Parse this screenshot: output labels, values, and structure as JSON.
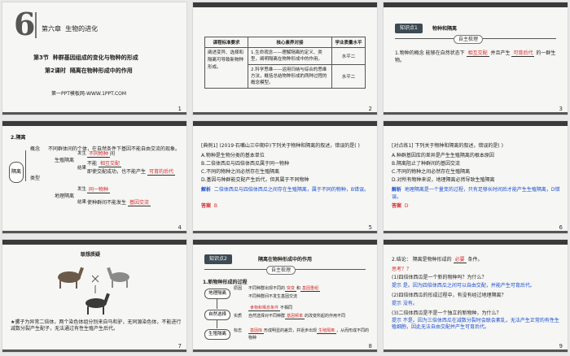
{
  "s1": {
    "big_num": "6",
    "chapter": "第六章",
    "chapter_title": "生物的进化",
    "section": "第3节",
    "section_title": "种群基因组成的变化与物种的形成",
    "lesson": "第2课时",
    "lesson_title": "隔离在物种形成中的作用",
    "credit": "第一PPT模板网-WWW.1PPT.COM",
    "page": "1"
  },
  "s2": {
    "headers": [
      "课程标准要求",
      "核心素养对接",
      "学业质量水平"
    ],
    "left_text": "阐述变异、选择和隔离可导致新物种形成。",
    "rows": [
      {
        "core": "1.生命观念——理解隔离的定义、类型，阐明隔离在物种形成中的作用。",
        "level": "水平二"
      },
      {
        "core": "2.科学思维——运用归纳与综合的思维方法，概括总结物种形成的两种过程的概念模型。",
        "level": "水平二"
      }
    ],
    "page": "2"
  },
  "s3": {
    "tab": "知识点1",
    "tab_title": "物种和隔离",
    "pill": "自主梳理",
    "line1_prefix": "1.物种的概念 能够在自然状态下",
    "blank1": "相互交配",
    "line1_mid": "并且产生",
    "blank2": "可育后代",
    "line1_suffix": "的一群生物。",
    "page": "3"
  },
  "s4": {
    "heading": "2.隔离",
    "root": "隔离",
    "concept_label": "概念",
    "concept_text": "不同群体间的个体，在自然条件下基因不能自由交流的现象。",
    "types_label": "类型",
    "geo": "地理隔离",
    "repro": "生殖隔离",
    "happen": "发生",
    "result": "结果",
    "fill_diff_species": "不同物种",
    "fill_between": "间",
    "cannot": "不能",
    "fill_mate": "相互交配",
    "even_if": "即使交配成功，也不能产生",
    "fill_fertile": "可育的后代",
    "fill_same": "同一物种",
    "makes": "使种群间不能发生",
    "fill_gene": "基因交流",
    "page": "4"
  },
  "s5": {
    "q": "[典例1] (2019·石嘴山三中期中)下列关于物种和隔离的叙述，错误的是(     )",
    "opts": [
      "A.物种是生物分类的基本单位",
      "B.二倍体西瓜与四倍体西瓜属于同一物种",
      "C.不同的物种之间必然存在生殖隔离",
      "D.基因与种群能交配产生后代，但其属于不同物种"
    ],
    "explain_label": "解析",
    "explain": "二倍体西瓜与四倍体西瓜之间存在生殖隔离，属于不同的物种，B错误。",
    "answer_label": "答案",
    "answer": "B",
    "page": "5"
  },
  "s6": {
    "q": "[对点练1] 下列关于物种和隔离的叙述，错误的是(     )",
    "opts": [
      "A.种群基因库的差异是产生生殖隔离的根本原因",
      "B.隔离阻止了种群间的基因交流",
      "C.不同的物种之间必然存在生殖隔离",
      "D.对所有物种来说，地理隔离必然导致生殖隔离"
    ],
    "explain_label": "解析",
    "explain": "地理隔离是一个量变的过程，只有足够长时间后才能产生生殖隔离，D错误。",
    "answer_label": "答案",
    "answer": "D",
    "page": "6"
  },
  "s7": {
    "title": "联想质疑",
    "caption": "★骡子为异常二倍体，两个染色体组分别来自马和驴，无同源染色体，不能进行减数分裂产生配子，无法通过有性生殖产生后代。",
    "page": "7"
  },
  "s8": {
    "tab": "知识点2",
    "tab_title": "隔离在物种形成中的作用",
    "pill": "自主梳理",
    "heading": "1.新物种形成的过程",
    "node1": "地理隔离",
    "node2": "自然选择",
    "node3": "生殖隔离",
    "b1": "原因",
    "b2": "实质",
    "b3": "标志",
    "t1a": "不同种群出现不同的",
    "t1b": "突变",
    "t1c": "和",
    "t1d": "基因重组",
    "t2": "不同种群间不发生基因交流",
    "t3a": "食物和栖息条件",
    "t3b": "不相同",
    "t4a": "自然选择对不同种群",
    "t4b": "基因频率",
    "t4c": "的改变所起的作用不同",
    "t5a": "基因库",
    "t5b": "形成明显的差异，并逐步出现",
    "t5c": "生殖隔离",
    "t5d": "，从而形成不同的物种",
    "page": "8"
  },
  "s9": {
    "line1a": "2.结论：",
    "line1b": "隔离是物种形成的",
    "line1c": "必要",
    "line1d": "条件。",
    "think": "思考？？",
    "q1": "(1)四倍体西瓜是一个新的物种吗？为什么？",
    "a1": "提示  是。因为四倍体西瓜之间可以自由交配，并能产生可育后代。",
    "q2": "(2)四倍体西瓜的形成过程中，有没有经过地理隔离？",
    "a2": "提示  没有。",
    "q3": "(3)二倍体西瓜是不是一个独立的新物种，为什么？",
    "a3": "提示  不是。因为三倍体西瓜在减数分裂时会联会紊乱，无法产生正常的有性生殖细胞，因此无法自由交配并产生可育后代。",
    "page": "9"
  },
  "colors": {
    "accent_red": "#d62b2b",
    "accent_blue": "#1a4fd0",
    "tab_bg": "#3b4a53"
  }
}
